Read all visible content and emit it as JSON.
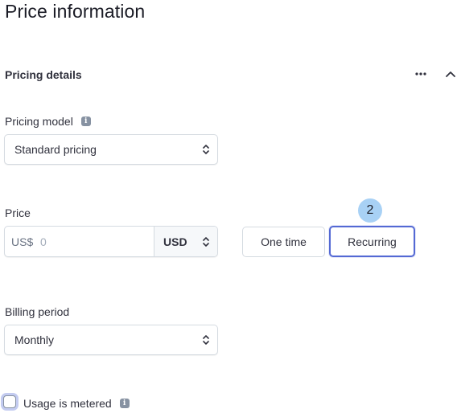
{
  "page": {
    "title": "Price information"
  },
  "pricing_details": {
    "title": "Pricing details",
    "more_icon": "more-horizontal-icon",
    "collapse_icon": "chevron-up-icon"
  },
  "pricing_model": {
    "label": "Pricing model",
    "info_icon": "info-icon",
    "info_glyph": "i",
    "selected": "Standard pricing"
  },
  "price": {
    "label": "Price",
    "prefix": "US$",
    "placeholder": "0",
    "value": "",
    "currency": "USD"
  },
  "price_type": {
    "step_badge": "2",
    "options": [
      "One time",
      "Recurring"
    ],
    "selected": "Recurring"
  },
  "billing_period": {
    "label": "Billing period",
    "selected": "Monthly"
  },
  "usage_metered": {
    "label": "Usage is metered",
    "checked": false,
    "info_glyph": "i"
  },
  "colors": {
    "accent": "#5469d4",
    "badge": "#a8d1f5",
    "text": "#30313d",
    "border": "#d5dbe1"
  }
}
